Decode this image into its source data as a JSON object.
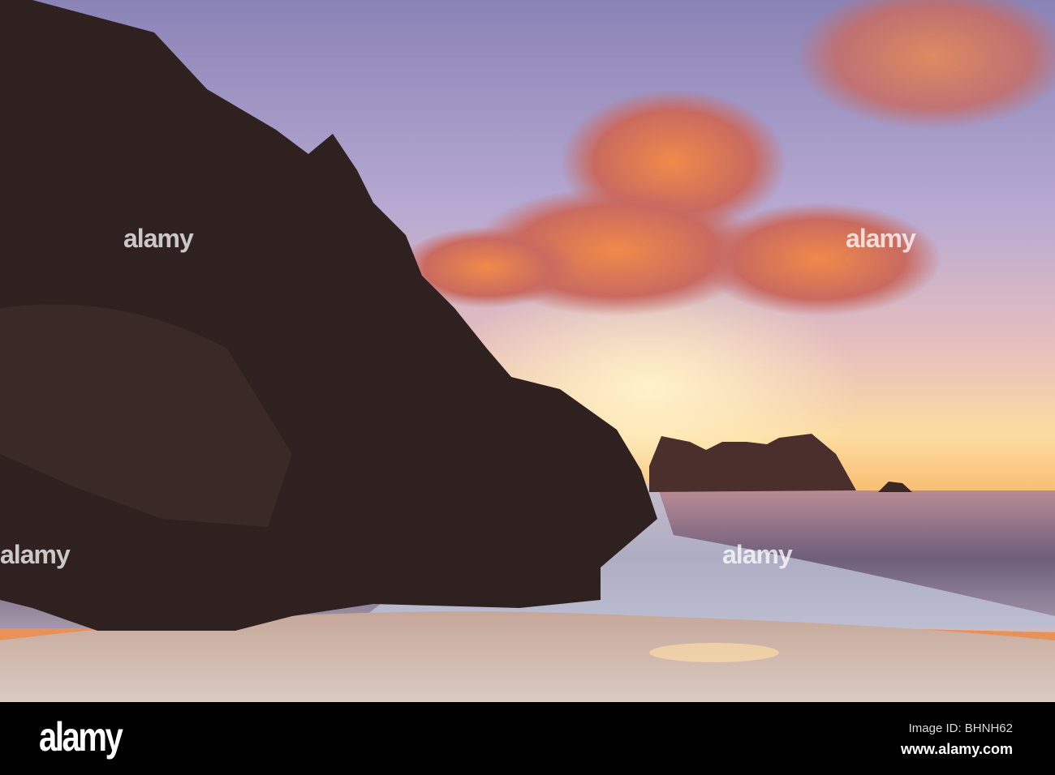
{
  "photo": {
    "subject": "sunset-coastal-cliff"
  },
  "watermark": {
    "text": "alamy"
  },
  "footer": {
    "logo": "alamy",
    "image_id": "Image ID: BHNH62",
    "url": "www.alamy.com"
  }
}
